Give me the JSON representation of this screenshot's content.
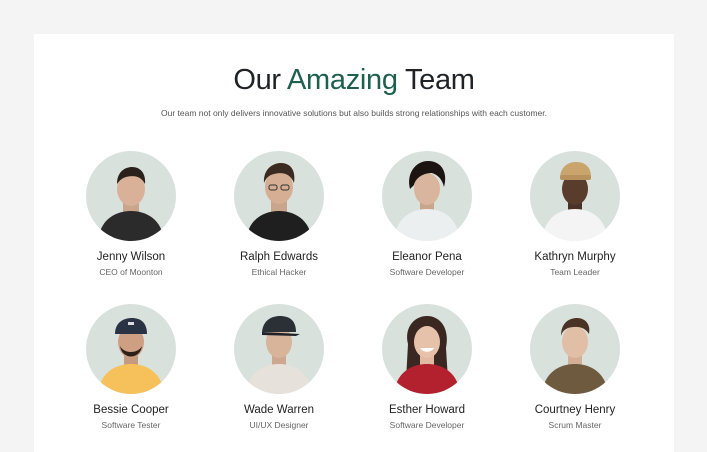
{
  "header": {
    "title_pre": "Our",
    "title_accent": "Amazing",
    "title_post": "Team",
    "subtitle": "Our team not only delivers innovative solutions but also builds strong relationships with each customer."
  },
  "colors": {
    "accent": "#1f5f4f",
    "avatar_bg": "#d9e1dd"
  },
  "members": [
    {
      "name": "Jenny Wilson",
      "role": "CEO of Moonton"
    },
    {
      "name": "Ralph Edwards",
      "role": "Ethical Hacker"
    },
    {
      "name": "Eleanor Pena",
      "role": "Software Developer"
    },
    {
      "name": "Kathryn Murphy",
      "role": "Team Leader"
    },
    {
      "name": "Bessie Cooper",
      "role": "Software Tester"
    },
    {
      "name": "Wade Warren",
      "role": "UI/UX Designer"
    },
    {
      "name": "Esther Howard",
      "role": "Software Developer"
    },
    {
      "name": "Courtney Henry",
      "role": "Scrum Master"
    }
  ]
}
